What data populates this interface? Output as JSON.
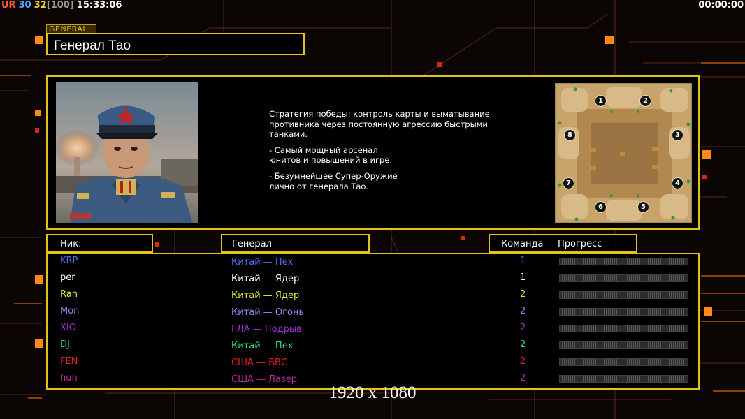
{
  "status_bar": {
    "left": {
      "ur": "UR",
      "a": "30",
      "b": "32",
      "c": "[100]",
      "time": "15:33:06"
    },
    "right_time": "00:00:00"
  },
  "general": {
    "tag": "GENERAL",
    "name": "Генерал Тао",
    "description": [
      "Стратегия победы: контроль карты и выматывание\n противника через постоянную агрессию быстрыми\n  танками.",
      "- Самый мощный арсенал\nюнитов и повышений в игре.",
      "- Безумнейшее Супер-Оружие\nлично от генерала Тао."
    ]
  },
  "map": {
    "slots": [
      "1",
      "2",
      "3",
      "4",
      "5",
      "6",
      "7",
      "8"
    ]
  },
  "table": {
    "headers": {
      "nick": "Ник:",
      "general": "Генерал",
      "team": "Команда",
      "progress": "Прогресс"
    },
    "players": [
      {
        "nick": "KRP",
        "general": "Китай — Пех",
        "team": "1",
        "color": "#4e6ff3"
      },
      {
        "nick": "per",
        "general": "Китай — Ядер",
        "team": "1",
        "color": "#ffffff"
      },
      {
        "nick": "Ran",
        "general": "Китай — Ядер",
        "team": "2",
        "color": "#e6e83a"
      },
      {
        "nick": "Mon",
        "general": "Китай — Огонь",
        "team": "2",
        "color": "#8a8cf0"
      },
      {
        "nick": "XIO",
        "general": "ГЛА — Подрыв",
        "team": "2",
        "color": "#9b31cf"
      },
      {
        "nick": "DJ",
        "general": "Китай — Пех",
        "team": "2",
        "color": "#33d477"
      },
      {
        "nick": "FEN",
        "general": "США — ВВС",
        "team": "2",
        "color": "#e02424"
      },
      {
        "nick": "hun",
        "general": "США — Лазер",
        "team": "2",
        "color": "#b32a9a"
      }
    ]
  },
  "resolution_label": "1920 x 1080",
  "colors": {
    "accent": "#e3c21c",
    "orange": "#ff8a1c",
    "background": "#0b0604"
  }
}
